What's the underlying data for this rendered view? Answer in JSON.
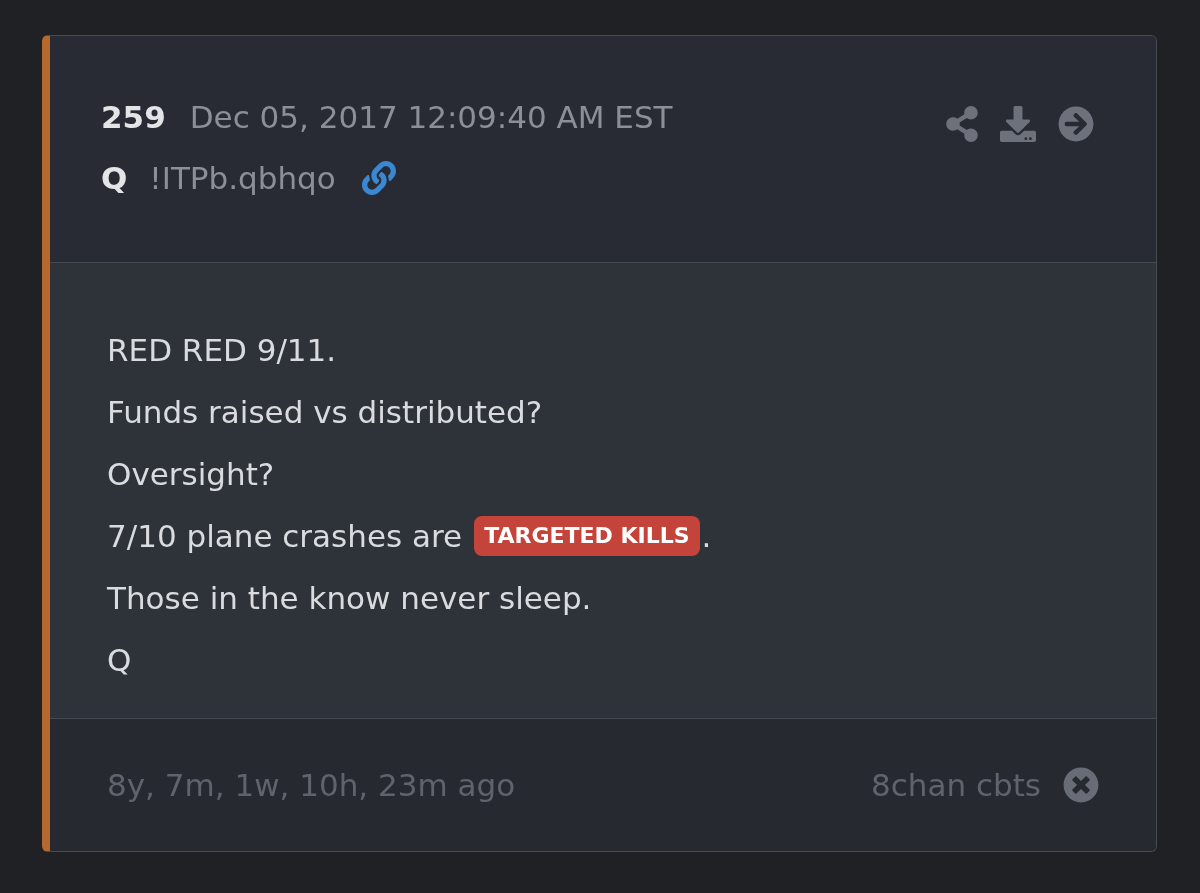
{
  "post": {
    "number": "259",
    "date": "Dec 05, 2017 12:09:40 AM EST",
    "author": "Q",
    "tripcode": "!ITPb.qbhqo"
  },
  "body": {
    "lines": [
      {
        "parts": [
          {
            "kind": "text",
            "text": "RED RED 9/11."
          }
        ]
      },
      {
        "parts": [
          {
            "kind": "text",
            "text": "Funds raised vs distributed?"
          }
        ]
      },
      {
        "parts": [
          {
            "kind": "text",
            "text": "Oversight?"
          }
        ]
      },
      {
        "parts": [
          {
            "kind": "text",
            "text": "7/10 plane crashes are"
          },
          {
            "kind": "tag",
            "text": "TARGETED KILLS"
          },
          {
            "kind": "text",
            "text": "."
          }
        ]
      },
      {
        "parts": [
          {
            "kind": "text",
            "text": "Those in the know never sleep."
          }
        ]
      },
      {
        "parts": [
          {
            "kind": "text",
            "text": "Q"
          }
        ]
      }
    ]
  },
  "footer": {
    "age": "8y, 7m, 1w, 10h, 23m ago",
    "source": "8chan cbts"
  }
}
